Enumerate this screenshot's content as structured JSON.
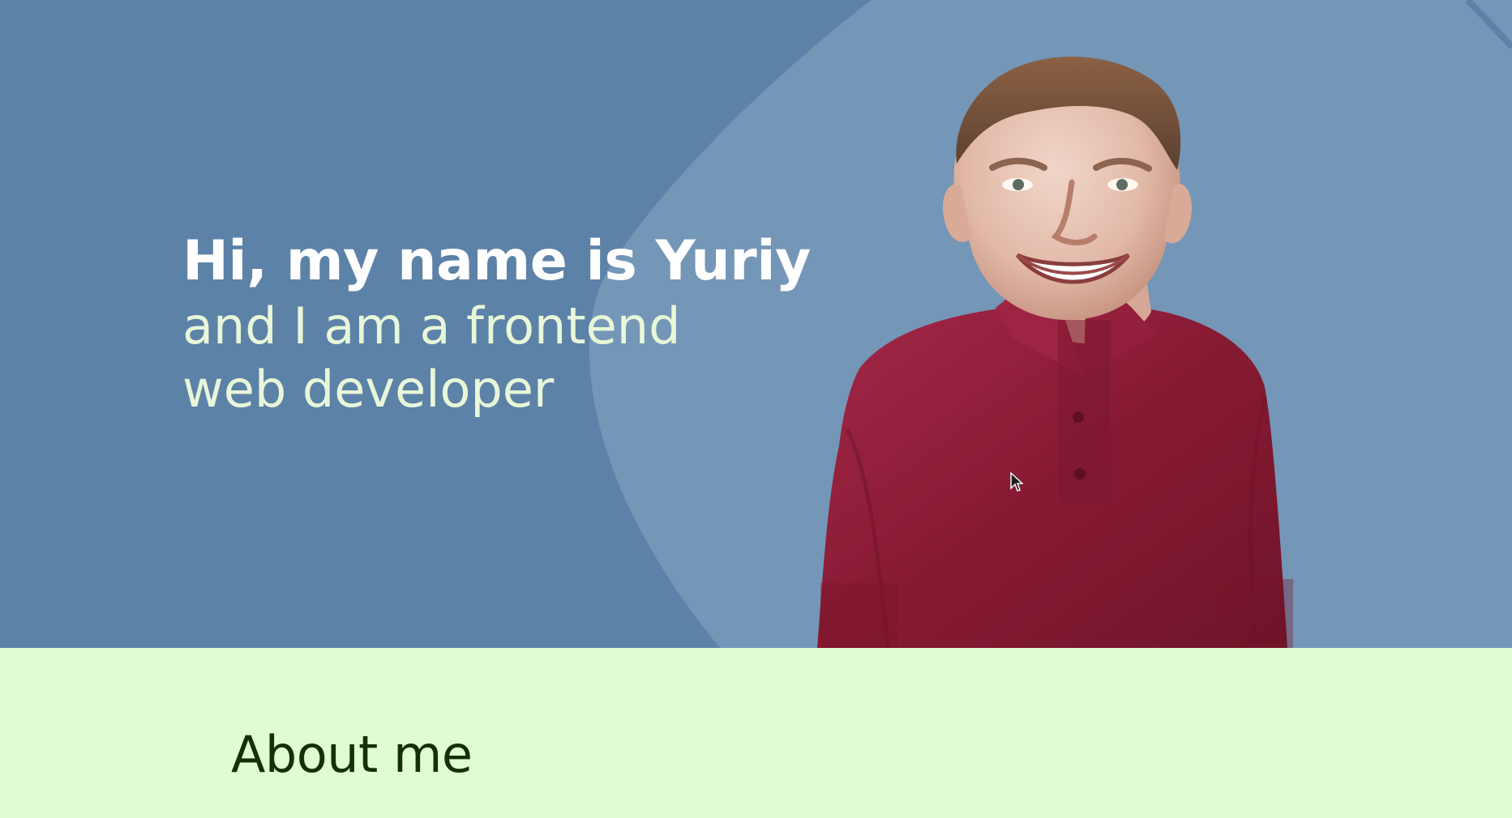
{
  "hero": {
    "title": "Hi, my name is Yuriy",
    "subtitle": "and I am a frontend web developer",
    "background_color": "#5d82a8",
    "blob_color": "#7496b7",
    "title_color": "#ffffff",
    "subtitle_color": "#e8f7d8",
    "portrait": {
      "icon": "person-photo",
      "shirt_color": "#8b1c35"
    }
  },
  "about": {
    "title": "About me",
    "background_color": "#defdd2",
    "title_color": "#14300b"
  },
  "cursor": {
    "icon": "mouse-pointer-icon"
  }
}
